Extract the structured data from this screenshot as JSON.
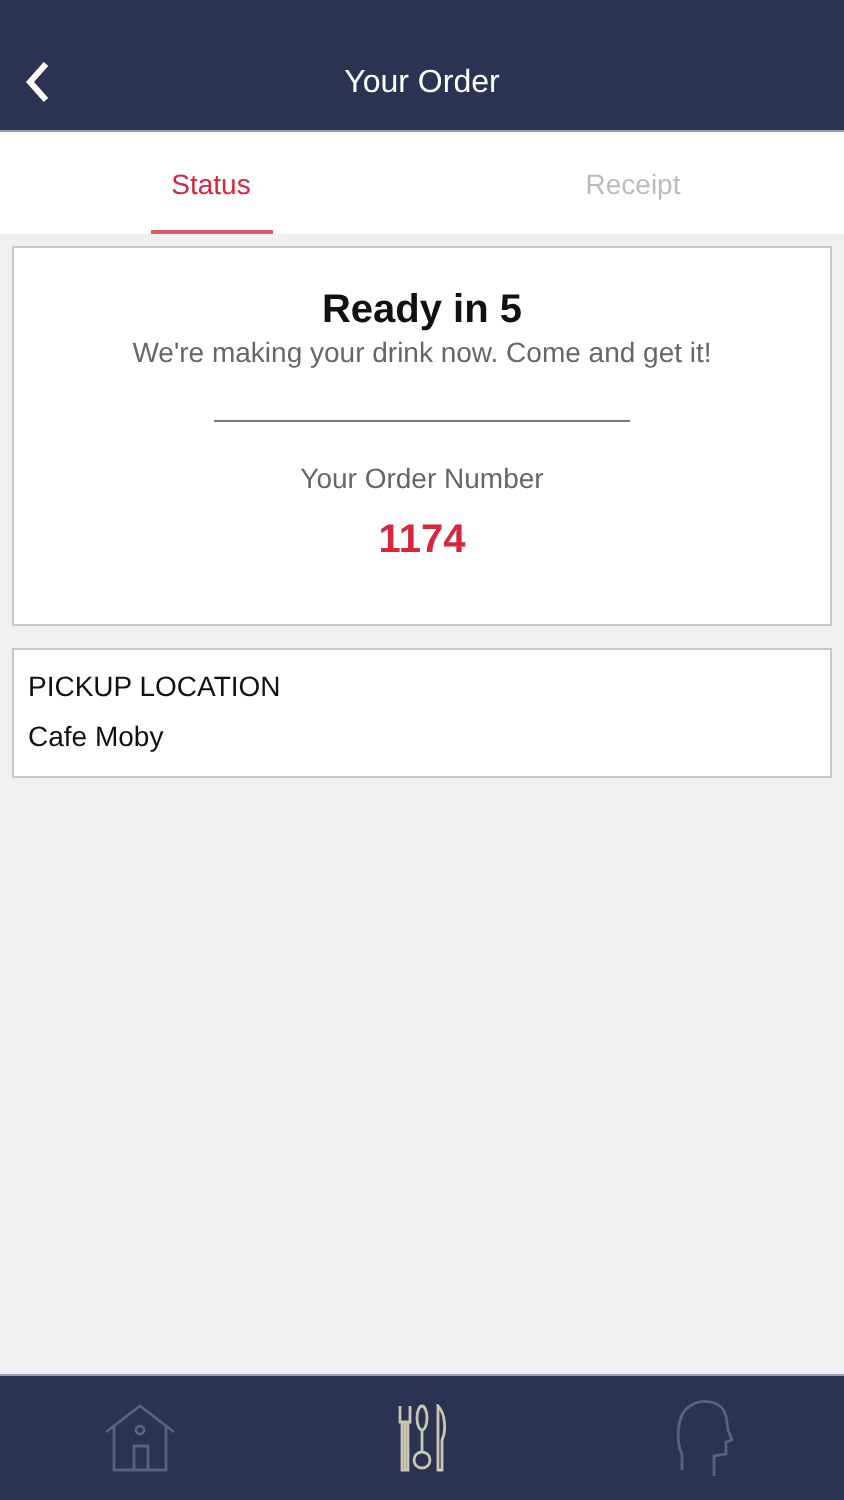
{
  "header": {
    "title": "Your Order"
  },
  "tabs": [
    {
      "label": "Status",
      "selected": true
    },
    {
      "label": "Receipt",
      "selected": false
    }
  ],
  "status_card": {
    "title": "Ready in 5",
    "message": "We're making your drink now. Come and get it!",
    "order_label": "Your Order Number",
    "order_number": "1174"
  },
  "pickup": {
    "heading": "PICKUP LOCATION",
    "location": "Cafe Moby"
  },
  "bottom_nav": [
    {
      "kind": "home",
      "selected": false
    },
    {
      "kind": "menu",
      "selected": true
    },
    {
      "kind": "profile",
      "selected": false
    }
  ]
}
